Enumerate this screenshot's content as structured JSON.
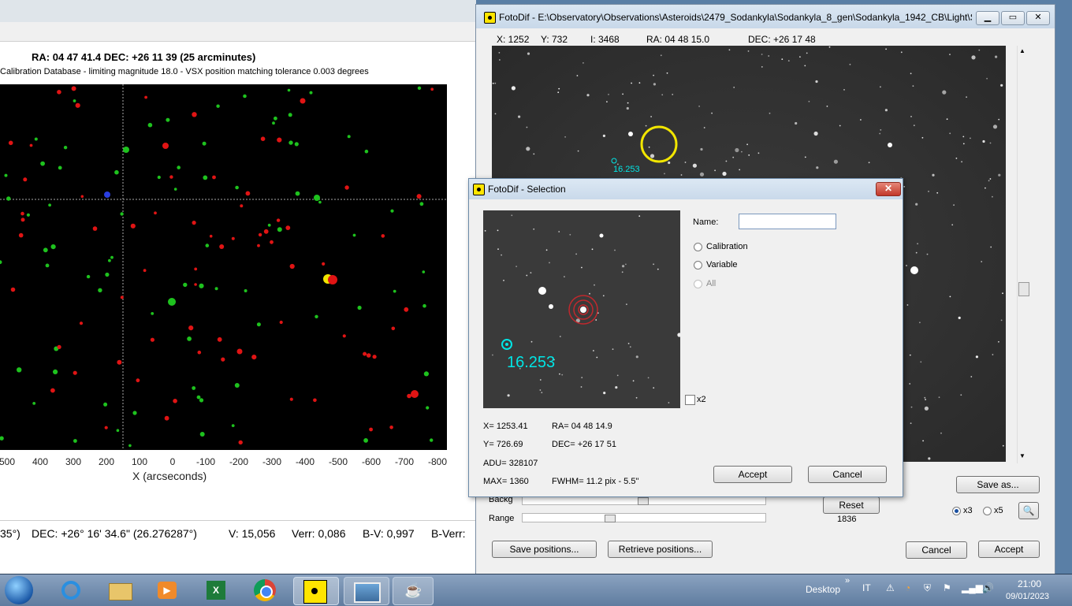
{
  "left_window": {
    "heading": "RA: 04 47 41.4   DEC: +26 11 39 (25 arcminutes)",
    "subheading": "Calibration Database - limiting magnitude 18.0 - VSX position matching tolerance 0.003 degrees",
    "x_ticks": [
      "500",
      "400",
      "300",
      "200",
      "100",
      "0",
      "-100",
      "-200",
      "-300",
      "-400",
      "-500",
      "-600",
      "-700",
      "-800"
    ],
    "x_axis_label": "X (arcseconds)",
    "info": {
      "ra_tail": "35°)",
      "dec": "DEC: +26° 16' 34.6\" (26.276287°)",
      "v": "V: 15,056",
      "verr": "Verr: 0,086",
      "bv": "B-V: 0,997",
      "bverr": "B-Verr:"
    }
  },
  "fotodif": {
    "title": "FotoDif - E:\\Observatory\\Observations\\Asteroids\\2479_Sodankyla\\Sodankyla_8_gen\\Sodankyla_1942_CB\\Light\\S...",
    "coords": {
      "x": "X: 1252",
      "y": "Y: 732",
      "i": "I: 3468",
      "ra": "RA: 04 48 15.0",
      "dec": "DEC: +26 17 48"
    },
    "star_label": "16.253",
    "backg_label": "Backg",
    "range_label": "Range",
    "reset_label": "Reset",
    "reset_value": "1836",
    "save_as_label": "Save as...",
    "zoom_x3": "x3",
    "zoom_x5": "x5",
    "zoom_selected": "x3",
    "save_positions_label": "Save positions...",
    "retrieve_positions_label": "Retrieve positions...",
    "cancel_label": "Cancel",
    "accept_label": "Accept"
  },
  "selection": {
    "title": "FotoDif - Selection",
    "name_label": "Name:",
    "name_value": "",
    "opt_calibration": "Calibration",
    "opt_variable": "Variable",
    "opt_all": "All",
    "x2_label": "x2",
    "star_label": "16.253",
    "x": "X= 1253.41",
    "y": "Y= 726.69",
    "adu": "ADU= 328107",
    "max": "MAX= 1360",
    "ra": "RA= 04 48 14.9",
    "dec": "DEC= +26 17 51",
    "fwhm": "FWHM= 11.2 pix - 5.5\"",
    "accept_label": "Accept",
    "cancel_label": "Cancel"
  },
  "taskbar": {
    "desktop_label": "Desktop",
    "lang": "IT",
    "time": "21:00",
    "date": "09/01/2023",
    "apps": [
      "windows-start-icon",
      "internet-explorer-icon",
      "file-explorer-icon",
      "media-player-icon",
      "excel-icon",
      "chrome-icon",
      "fotodif-icon",
      "photo-viewer-icon",
      "java-icon"
    ]
  }
}
